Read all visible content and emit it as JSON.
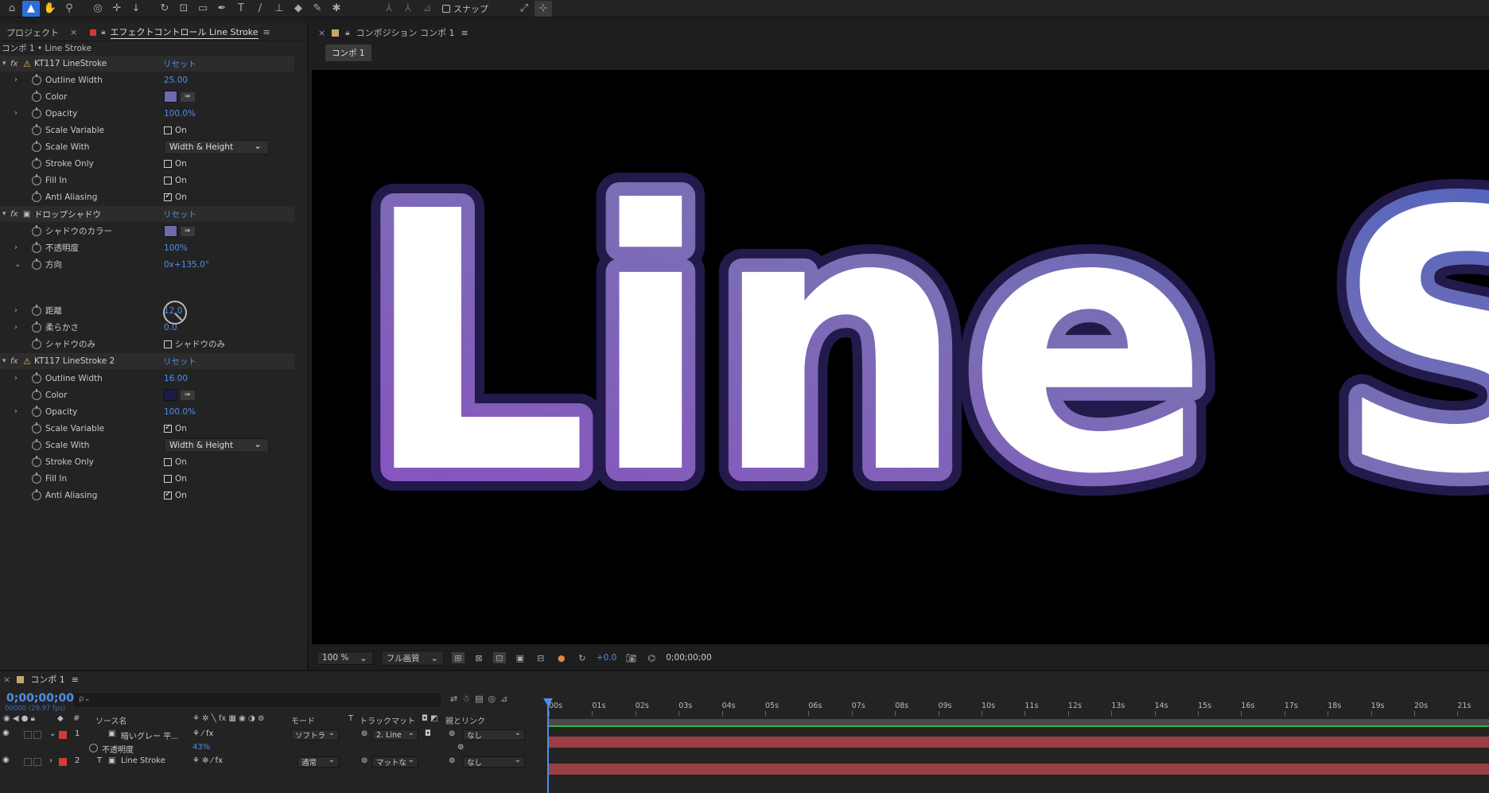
{
  "toolbar": {
    "icons": [
      "home-icon",
      "selection-tool",
      "hand-tool",
      "zoom-tool",
      "orbit-tool",
      "pan-tool",
      "dolly-tool",
      "rotate-tool",
      "pan-behind-tool",
      "rectangle-tool",
      "pen-tool",
      "type-tool",
      "brush-tool",
      "clone-stamp-tool",
      "eraser-tool",
      "roto-brush-tool",
      "puppet-tool"
    ],
    "snap_label": "スナップ"
  },
  "effects_panel": {
    "tab_project": "プロジェクト",
    "tab_effects": "エフェクトコントロール Line Stroke",
    "breadcrumb": "コンポ 1 • Line Stroke",
    "effect1": {
      "name": "KT117 LineStroke",
      "reset": "リセット",
      "outline_width_label": "Outline Width",
      "outline_width": "25.00",
      "color_label": "Color",
      "color": "#6f6aad",
      "opacity_label": "Opacity",
      "opacity": "100.0%",
      "scale_variable_label": "Scale Variable",
      "scale_variable_on": false,
      "scale_with_label": "Scale With",
      "scale_with": "Width & Height",
      "stroke_only_label": "Stroke Only",
      "stroke_only_on": false,
      "fill_in_label": "Fill In",
      "fill_in_on": false,
      "anti_aliasing_label": "Anti Aliasing",
      "anti_aliasing_on": true,
      "on_label": "On"
    },
    "effect2": {
      "name": "ドロップシャドウ",
      "reset": "リセット",
      "shadow_color_label": "シャドウのカラー",
      "shadow_color": "#6f6aad",
      "opacity_label": "不透明度",
      "opacity": "100%",
      "direction_label": "方向",
      "direction": "0x+135.0°",
      "distance_label": "距離",
      "distance": "12.0",
      "softness_label": "柔らかさ",
      "softness": "0.0",
      "shadow_only_label": "シャドウのみ",
      "shadow_only_check": "シャドウのみ"
    },
    "effect3": {
      "name": "KT117 LineStroke 2",
      "reset": "リセット",
      "outline_width_label": "Outline Width",
      "outline_width": "16.00",
      "color_label": "Color",
      "color": "#1c1a4a",
      "opacity_label": "Opacity",
      "opacity": "100.0%",
      "scale_variable_label": "Scale Variable",
      "scale_variable_on": true,
      "scale_with_label": "Scale With",
      "scale_with": "Width & Height",
      "stroke_only_label": "Stroke Only",
      "stroke_only_on": false,
      "fill_in_label": "Fill In",
      "fill_in_on": false,
      "anti_aliasing_label": "Anti Aliasing",
      "anti_aliasing_on": true,
      "on_label": "On"
    }
  },
  "composition": {
    "tab_label": "コンポジション コンポ 1",
    "chip": "コンポ 1",
    "viewer_text": "Line S",
    "zoom": "100 %",
    "quality": "フル画質",
    "exposure": "+0.0",
    "timecode": "0;00;00;00"
  },
  "timeline": {
    "tab_label": "コンポ 1",
    "timecode": "0;00;00;00",
    "fps": "00000 (29.97 fps)",
    "search_placeholder": "ρ⌄",
    "col_source": "ソース名",
    "col_mode": "モード",
    "col_t": "T",
    "col_trackmatte": "トラックマット",
    "col_parent": "親とリンク",
    "col_hash": "#",
    "layers": [
      {
        "num": "1",
        "name": "暗いグレー 平...",
        "mode": "ソフトラ",
        "matte": "2. Line",
        "parent": "なし"
      },
      {
        "num": "2",
        "name": "Line Stroke",
        "mode": "通常",
        "matte": "マットな",
        "parent": "なし"
      }
    ],
    "sub_property_label": "不透明度",
    "sub_property_value": "43%",
    "ruler": [
      "00s",
      "01s",
      "02s",
      "03s",
      "04s",
      "05s",
      "06s",
      "07s",
      "08s",
      "09s",
      "10s",
      "11s",
      "12s",
      "13s",
      "14s",
      "15s",
      "16s",
      "17s",
      "18s",
      "19s",
      "20s",
      "21s"
    ]
  }
}
